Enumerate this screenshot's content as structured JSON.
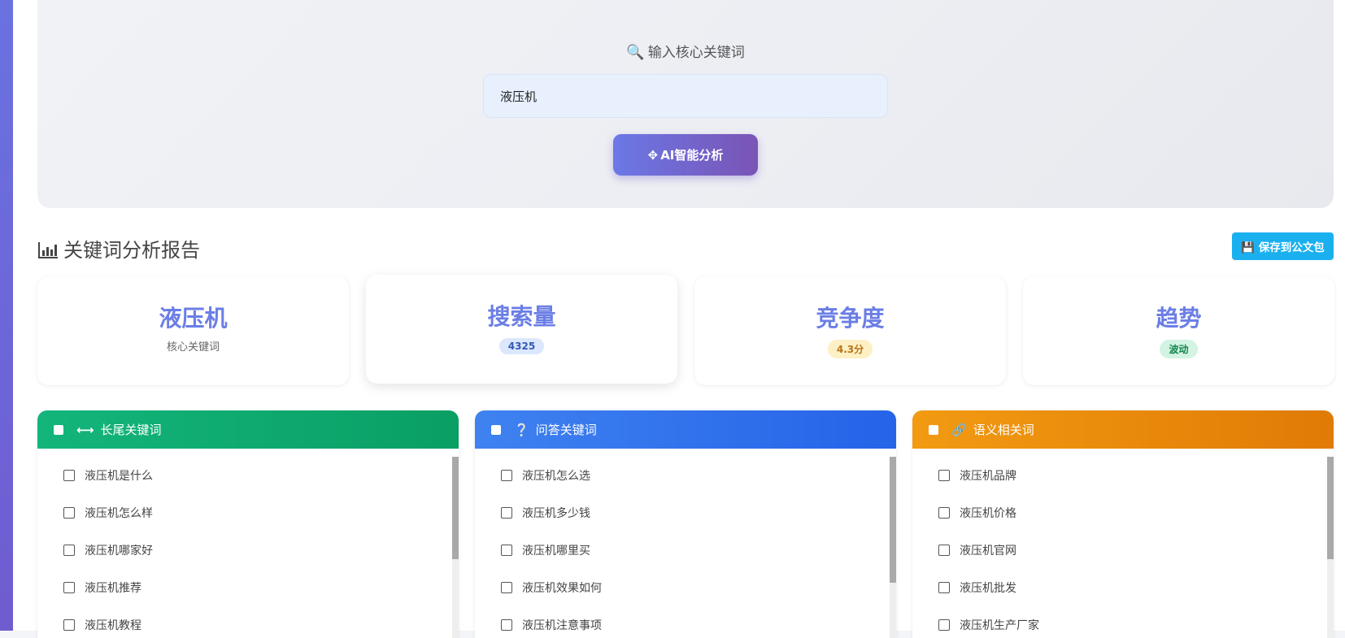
{
  "search": {
    "label": "输入核心关键词",
    "value": "液压机",
    "button_label": "AI智能分析"
  },
  "report": {
    "title": "关键词分析报告",
    "save_label": "保存到公文包"
  },
  "stats": [
    {
      "title": "液压机",
      "sub": "核心关键词"
    },
    {
      "title": "搜索量",
      "badge": "4325",
      "badge_color": "#dbe7fd"
    },
    {
      "title": "竞争度",
      "badge": "4.3分",
      "badge_color": "#fdf0c4"
    },
    {
      "title": "趋势",
      "badge": "波动",
      "badge_color": "#d3f3e3"
    }
  ],
  "panels": [
    {
      "title": "长尾关键词",
      "icon": "arrows-horizontal-icon",
      "color": "#0fa86e",
      "items": [
        "液压机是什么",
        "液压机怎么样",
        "液压机哪家好",
        "液压机推荐",
        "液压机教程"
      ]
    },
    {
      "title": "问答关键词",
      "icon": "question-circle-icon",
      "color": "#2f6eec",
      "items": [
        "液压机怎么选",
        "液压机多少钱",
        "液压机哪里买",
        "液压机效果如何",
        "液压机注意事项"
      ]
    },
    {
      "title": "语义相关词",
      "icon": "link-icon",
      "color": "#ea8b0c",
      "items": [
        "液压机品牌",
        "液压机价格",
        "液压机官网",
        "液压机批发",
        "液压机生产厂家"
      ]
    }
  ],
  "colors": {
    "accent": "#6b7ee6",
    "save_button": "#1ab0f0",
    "rail": "#6a72e0"
  }
}
